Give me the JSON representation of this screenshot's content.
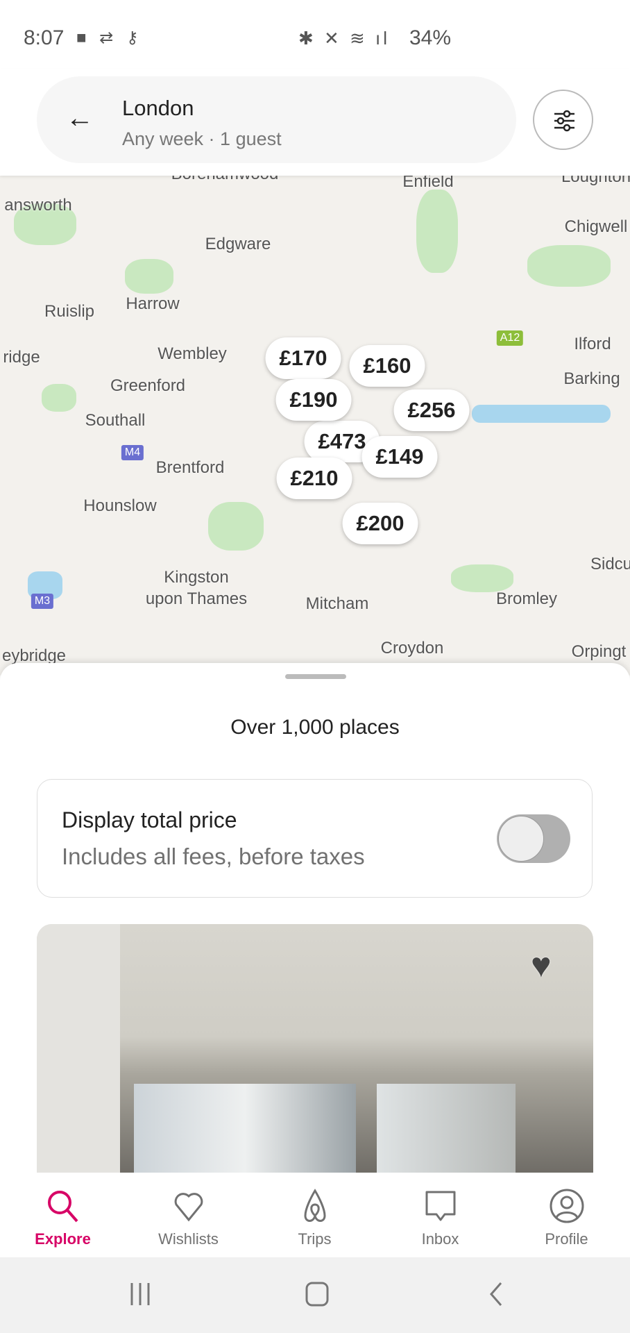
{
  "status_bar": {
    "time": "8:07",
    "battery": "34%"
  },
  "search": {
    "location": "London",
    "details": "Any week · 1 guest"
  },
  "map": {
    "labels": [
      "Borehamwood",
      "Enfield",
      "Loughton",
      "answorth",
      "Edgware",
      "Chigwell",
      "Ruislip",
      "Harrow",
      "Wembley",
      "Ilford",
      "ridge",
      "Greenford",
      "Barking",
      "Southall",
      "Brentford",
      "Hounslow",
      "Kingston",
      "upon Thames",
      "Mitcham",
      "Bromley",
      "Sidcu",
      "Croydon",
      "eybridge",
      "Orpingt"
    ],
    "roads": [
      "M4",
      "M3",
      "A12"
    ],
    "prices": [
      "£170",
      "£160",
      "£190",
      "£256",
      "£473",
      "£149",
      "£210",
      "£200"
    ]
  },
  "sheet": {
    "count": "Over 1,000 places",
    "toggle_title": "Display total price",
    "toggle_subtitle": "Includes all fees, before taxes",
    "toggle_on": false
  },
  "nav": {
    "items": [
      {
        "label": "Explore",
        "active": true
      },
      {
        "label": "Wishlists"
      },
      {
        "label": "Trips"
      },
      {
        "label": "Inbox"
      },
      {
        "label": "Profile"
      }
    ]
  },
  "colors": {
    "accent": "#d70466"
  }
}
